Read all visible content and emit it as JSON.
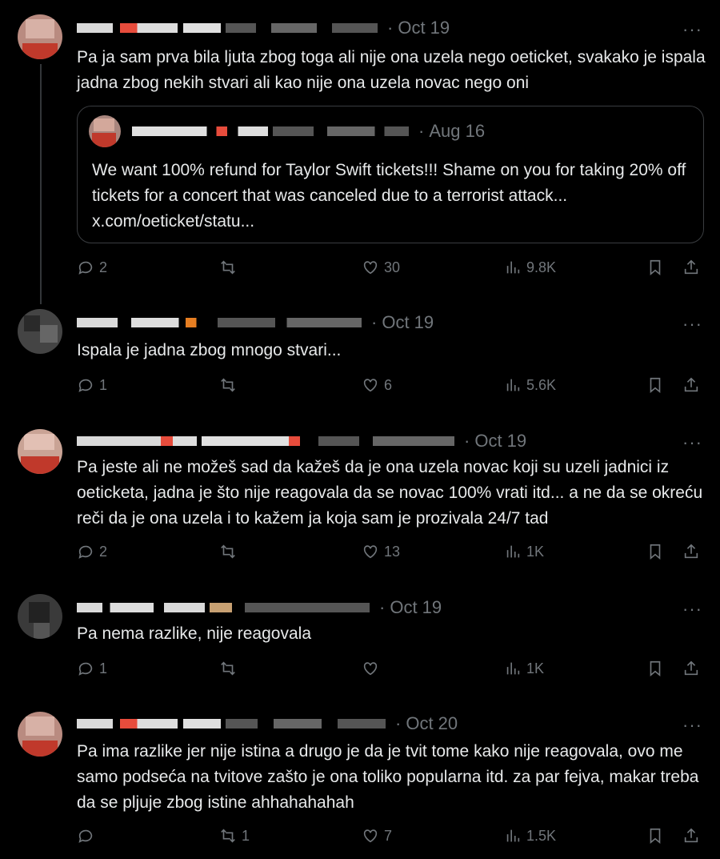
{
  "thread": [
    {
      "date": "Oct 19",
      "more": "···",
      "text": "Pa ja sam prva bila ljuta zbog toga ali nije ona uzela nego oeticket, svakako je ispala jadna zbog nekih stvari ali kao nije ona uzela novac nego oni",
      "quote": {
        "date": "Aug 16",
        "text": "We want 100% refund for Taylor Swift tickets!!! Shame on you for taking 20% off tickets for a concert that was canceled due to a terrorist attack... x.com/oeticket/statu..."
      },
      "replies": "2",
      "retweets": "",
      "likes": "30",
      "views": "9.8K"
    },
    {
      "date": "Oct 19",
      "more": "···",
      "text": "Ispala je jadna zbog mnogo stvari...",
      "replies": "1",
      "retweets": "",
      "likes": "6",
      "views": "5.6K"
    },
    {
      "date": "Oct 19",
      "more": "···",
      "text": "Pa jeste ali ne možeš sad da kažeš da je ona uzela novac koji su uzeli jadnici iz oeticketa, jadna je što nije reagovala da se novac 100% vrati itd... a ne da se okreću reči da je ona uzela i to kažem ja koja sam je prozivala 24/7 tad",
      "replies": "2",
      "retweets": "",
      "likes": "13",
      "views": "1K"
    },
    {
      "date": "Oct 19",
      "more": "···",
      "text": "Pa nema razlike, nije reagovala",
      "replies": "1",
      "retweets": "",
      "likes": "",
      "views": "1K"
    },
    {
      "date": "Oct 20",
      "more": "···",
      "text": "Pa ima razlike jer nije istina a drugo je da je tvit tome kako nije reagovala, ovo me samo podseća na tvitove zašto je ona toliko popularna itd. za par fejva, makar treba da se pljuje zbog istine ahhahahahah",
      "replies": "",
      "retweets": "1",
      "likes": "7",
      "views": "1.5K"
    }
  ],
  "colors": {
    "background": "#000000",
    "text": "#e7e9ea",
    "muted": "#71767b",
    "border": "#3a3d40"
  },
  "icons": [
    "reply-icon",
    "retweet-icon",
    "like-icon",
    "views-icon",
    "bookmark-icon",
    "share-icon",
    "more-icon"
  ]
}
